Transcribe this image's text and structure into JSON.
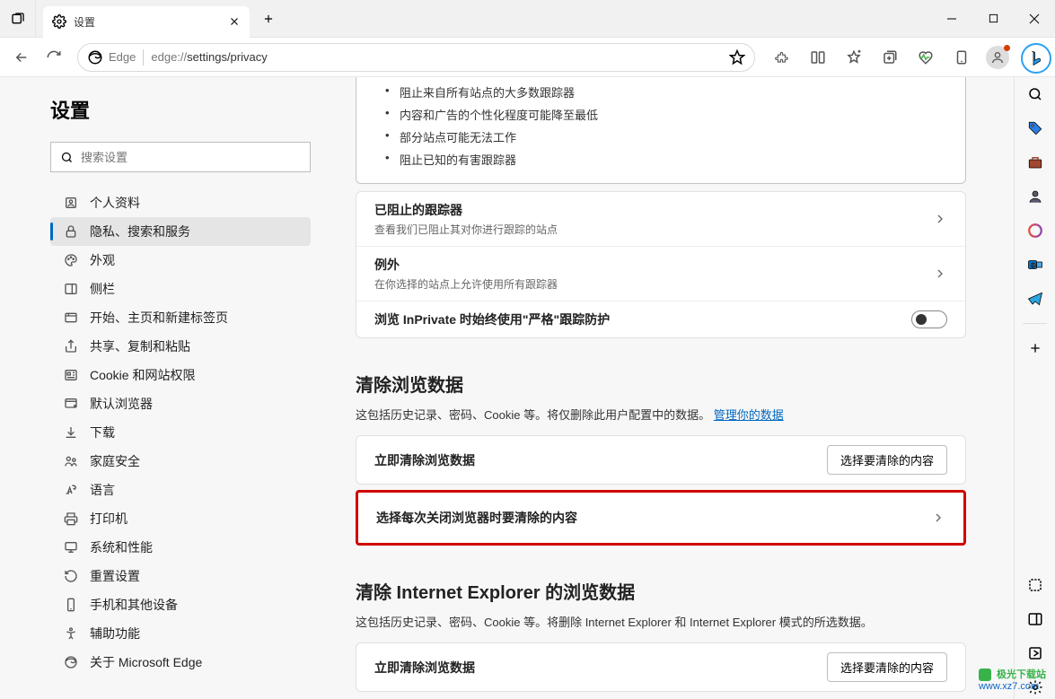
{
  "window": {
    "tab_title": "设置"
  },
  "addressbar": {
    "prefix": "Edge",
    "url": "edge://settings/privacy"
  },
  "sidebar": {
    "title": "设置",
    "search_placeholder": "搜索设置",
    "items": [
      {
        "label": "个人资料"
      },
      {
        "label": "隐私、搜索和服务"
      },
      {
        "label": "外观"
      },
      {
        "label": "侧栏"
      },
      {
        "label": "开始、主页和新建标签页"
      },
      {
        "label": "共享、复制和粘贴"
      },
      {
        "label": "Cookie 和网站权限"
      },
      {
        "label": "默认浏览器"
      },
      {
        "label": "下载"
      },
      {
        "label": "家庭安全"
      },
      {
        "label": "语言"
      },
      {
        "label": "打印机"
      },
      {
        "label": "系统和性能"
      },
      {
        "label": "重置设置"
      },
      {
        "label": "手机和其他设备"
      },
      {
        "label": "辅助功能"
      },
      {
        "label": "关于 Microsoft Edge"
      }
    ]
  },
  "content": {
    "tracking_bullets": [
      "阻止来自所有站点的大多数跟踪器",
      "内容和广告的个性化程度可能降至最低",
      "部分站点可能无法工作",
      "阻止已知的有害跟踪器"
    ],
    "blocked_trackers": {
      "title": "已阻止的跟踪器",
      "desc": "查看我们已阻止其对你进行跟踪的站点"
    },
    "exceptions": {
      "title": "例外",
      "desc": "在你选择的站点上允许使用所有跟踪器"
    },
    "inprivate": {
      "title": "浏览 InPrivate 时始终使用\"严格\"跟踪防护"
    },
    "clear_section": {
      "heading": "清除浏览数据",
      "sub_prefix": "这包括历史记录、密码、Cookie 等。将仅删除此用户配置中的数据。",
      "link": "管理你的数据"
    },
    "clear_now": {
      "title": "立即清除浏览数据",
      "button": "选择要清除的内容"
    },
    "clear_on_close": {
      "title": "选择每次关闭浏览器时要清除的内容"
    },
    "ie_section": {
      "heading": "清除 Internet Explorer 的浏览数据",
      "sub": "这包括历史记录、密码、Cookie 等。将删除 Internet Explorer 和 Internet Explorer 模式的所选数据。"
    },
    "ie_clear_now": {
      "title": "立即清除浏览数据",
      "button": "选择要清除的内容"
    }
  },
  "watermark": {
    "brand": "极光下载站",
    "url": "www.xz7.com"
  }
}
